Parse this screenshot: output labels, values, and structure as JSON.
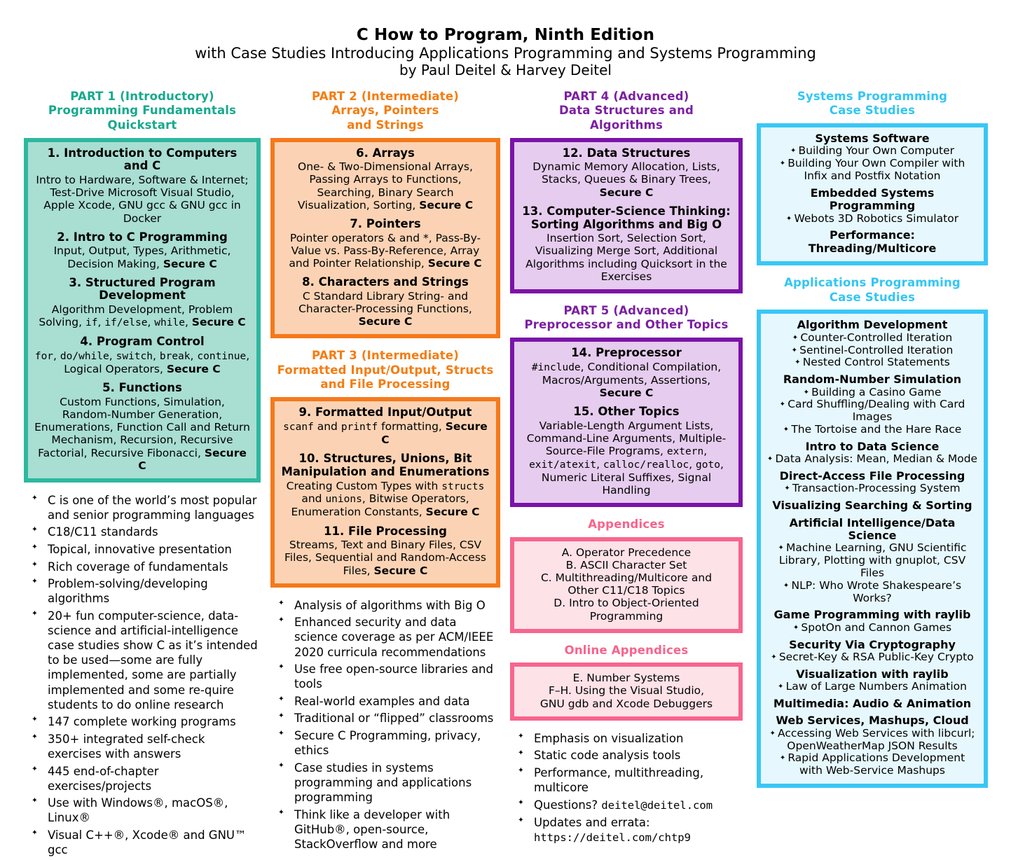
{
  "header": {
    "title": "C How to Program, Ninth Edition",
    "subtitle": "with Case Studies Introducing Applications Programming and Systems Programming",
    "byline": "by Paul Deitel & Harvey Deitel"
  },
  "colors": {
    "teal_border": "#2eb8a0",
    "teal_fill": "#a9ded2",
    "teal_heading": "#16a98c",
    "orange_border": "#f5791a",
    "orange_fill": "#fbd3b4",
    "orange_heading": "#f57c10",
    "purple_border": "#7b13a8",
    "purple_fill": "#e6ccee",
    "purple_heading": "#7b1fa2",
    "pink_border": "#f8658d",
    "pink_fill": "#fde2e8",
    "pink_heading": "#f9638c",
    "cyan_border": "#3ac7f5",
    "cyan_fill": "#e6f8fd",
    "cyan_heading": "#33c6f4"
  },
  "part1": {
    "heading": "PART 1 (Introductory)\nProgramming Fundamentals\nQuickstart",
    "chapters": [
      {
        "title": "1. Introduction to Computers and C",
        "desc": "Intro to Hardware, Software & Internet; Test-Drive Microsoft Visual Studio, Apple Xcode, GNU gcc & GNU gcc in Docker"
      },
      {
        "title": "2. Intro to C Programming",
        "desc_a": "Input, Output, Types, Arithmetic, Decision Making, ",
        "desc_secure": "Secure C"
      },
      {
        "title": "3. Structured Program Development",
        "desc_a": "Algorithm Development, Problem Solving, ",
        "code1": "if",
        "sep1": ", ",
        "code2": "if/else",
        "sep2": ", ",
        "code3": "while",
        "sep3": ", ",
        "desc_secure": "Secure C"
      },
      {
        "title": "4. Program Control",
        "code1": "for",
        "sep1": ", ",
        "code2": "do/while",
        "sep2": ", ",
        "code3": "switch",
        "sep3": ", ",
        "code4": "break",
        "sep4": ", ",
        "code5": "continue",
        "desc_a": ", Logical Operators, ",
        "desc_secure": "Secure C"
      },
      {
        "title": "5. Functions",
        "desc_a": "Custom Functions, Simulation, Random-Number Generation, Enumerations, Function Call and Return Mechanism, Recursion, Recursive Factorial, Recursive Fibonacci, ",
        "desc_secure": "Secure C"
      }
    ],
    "bullets": [
      "C is one of the world’s most popular and senior programming languages",
      "C18/C11 standards",
      "Topical, innovative presentation",
      "Rich coverage of fundamentals",
      "Problem-solving/developing algorithms",
      "20+ fun computer-science, data-science and artificial-intelligence case studies show C as it’s intended to be used—some are fully implemented, some are partially implemented and some re-quire students to do online research",
      "147 complete working programs",
      "350+ integrated self-check exercises with answers",
      "445 end-of-chapter exercises/projects",
      "Use with Windows®, macOS®, Linux®",
      "Visual C++®, Xcode® and GNU™ gcc"
    ]
  },
  "part2": {
    "heading": "PART 2 (Intermediate)\nArrays, Pointers\nand Strings",
    "chapters": [
      {
        "title": "6. Arrays",
        "desc_a": "One- & Two-Dimensional Arrays, Passing Arrays to Functions, Searching, Binary Search Visualization, Sorting, ",
        "desc_secure": "Secure C"
      },
      {
        "title": "7. Pointers",
        "desc_a": "Pointer operators & and *, Pass-By-Value vs. Pass-By-Reference, Array and Pointer Relationship, ",
        "desc_secure": "Secure C"
      },
      {
        "title": "8. Characters and Strings",
        "desc_a": "C Standard Library String- and Character-Processing Functions, ",
        "desc_secure": "Secure C"
      }
    ]
  },
  "part3": {
    "heading": "PART 3 (Intermediate)\nFormatted Input/Output, Structs\nand File Processing",
    "chapters": [
      {
        "title": "9. Formatted Input/Output",
        "code1": "scanf",
        "mid": " and ",
        "code2": "printf",
        "desc_a": " formatting, ",
        "desc_secure": "Secure C"
      },
      {
        "title": "10. Structures, Unions, Bit Manipulation and Enumerations",
        "desc_a": "Creating Custom Types with ",
        "code1": "structs",
        "mid": " and ",
        "code2": "unions",
        "desc_b": ", Bitwise Operators, Enumeration Constants, ",
        "desc_secure": "Secure C"
      },
      {
        "title": "11. File Processing",
        "desc_a": "Streams, Text and Binary Files, CSV Files, Sequential and Random-Access Files, ",
        "desc_secure": "Secure C"
      }
    ],
    "bullets": [
      "Analysis of algorithms with Big O",
      "Enhanced security and data science coverage as per ACM/IEEE 2020 curricula recommendations",
      "Use free open-source libraries and tools",
      "Real-world examples and data",
      "Traditional or “flipped” classrooms",
      "Secure C Programming, privacy, ethics",
      "Case studies in systems programming and applications programming",
      "Think like a developer with GitHub®, open-source, StackOverflow and more"
    ]
  },
  "part4": {
    "heading": "PART 4 (Advanced)\nData Structures and\nAlgorithms",
    "chapters": [
      {
        "title": "12. Data Structures",
        "desc_a": "Dynamic Memory Allocation, Lists, Stacks, Queues & Binary Trees, ",
        "desc_secure": "Secure C"
      },
      {
        "title": "13. Computer-Science Thinking: Sorting Algorithms and Big O",
        "desc_a": "Insertion Sort, Selection Sort, Visualizing Merge Sort, Additional Algorithms including Quicksort in the Exercises"
      }
    ]
  },
  "part5": {
    "heading": "PART 5 (Advanced)\nPreprocessor and Other Topics",
    "chapters": [
      {
        "title": "14. Preprocessor",
        "code1": "#include",
        "desc_a": ", Conditional Compilation, Macros/Arguments, Assertions, ",
        "desc_secure": "Secure C"
      },
      {
        "title": "15. Other Topics",
        "desc_a": "Variable-Length Argument Lists, Command-Line Arguments, Multiple-Source-File Programs, ",
        "code1": "extern",
        "sep1": ", ",
        "code2": "exit/atexit",
        "sep2": ", ",
        "code3": "calloc/realloc",
        "sep3": ", ",
        "code4": "goto",
        "desc_b": ", Numeric Literal Suffixes, Signal Handling"
      }
    ]
  },
  "appendices": {
    "heading": "Appendices",
    "items": [
      "A. Operator Precedence",
      "B. ASCII Character Set",
      "C. Multithreading/Multicore and",
      "Other C11/C18 Topics",
      "D. Intro to Object-Oriented Programming"
    ]
  },
  "online_appendices": {
    "heading": "Online Appendices",
    "items": [
      "E. Number Systems",
      "F–H. Using the Visual Studio,",
      "GNU gdb and Xcode Debuggers"
    ]
  },
  "center_bullets": {
    "items": [
      "Emphasis on visualization",
      "Static code analysis tools",
      "Performance, multithreading, multicore"
    ],
    "questions_label": "Questions? ",
    "questions_email": "deitel@deitel.com",
    "updates_label": "Updates and errata:",
    "updates_url": "https://deitel.com/chtp9"
  },
  "systems_cs": {
    "heading": "Systems Programming\nCase Studies",
    "groups": [
      {
        "head": "Systems Software",
        "items": [
          "Building Your Own Computer",
          "Building Your Own Compiler with Infix and Postfix Notation"
        ]
      },
      {
        "head": "Embedded Systems Programming",
        "items": [
          "Webots 3D Robotics Simulator"
        ]
      },
      {
        "head": "Performance: Threading/Multicore",
        "items": []
      }
    ]
  },
  "apps_cs": {
    "heading": "Applications Programming\nCase Studies",
    "groups": [
      {
        "head": "Algorithm Development",
        "items": [
          "Counter-Controlled Iteration",
          "Sentinel-Controlled Iteration",
          "Nested Control Statements"
        ]
      },
      {
        "head": "Random-Number Simulation",
        "items": [
          "Building a Casino Game",
          "Card Shuffling/Dealing with Card Images",
          "The Tortoise and the Hare Race"
        ]
      },
      {
        "head": "Intro to Data Science",
        "items": [
          "Data Analysis: Mean, Median & Mode"
        ]
      },
      {
        "head": "Direct-Access File Processing",
        "items": [
          "Transaction-Processing System"
        ]
      },
      {
        "head": "Visualizing Searching & Sorting",
        "items": []
      },
      {
        "head": "Artificial Intelligence/Data Science",
        "items": [
          "Machine Learning, GNU Scientific Library, Plotting with gnuplot, CSV Files",
          "NLP: Who Wrote Shakespeare’s Works?"
        ]
      },
      {
        "head": "Game Programming with raylib",
        "items": [
          "SpotOn and Cannon Games"
        ]
      },
      {
        "head": "Security Via Cryptography",
        "items": [
          "Secret-Key & RSA Public-Key Crypto"
        ]
      },
      {
        "head": "Visualization with raylib",
        "items": [
          "Law of Large Numbers Animation"
        ]
      },
      {
        "head": "Multimedia: Audio & Animation",
        "items": []
      },
      {
        "head": "Web Services, Mashups, Cloud",
        "items": [
          "Accessing Web Services with libcurl; OpenWeatherMap JSON Results",
          "Rapid Applications Development with Web-Service Mashups"
        ]
      }
    ]
  }
}
